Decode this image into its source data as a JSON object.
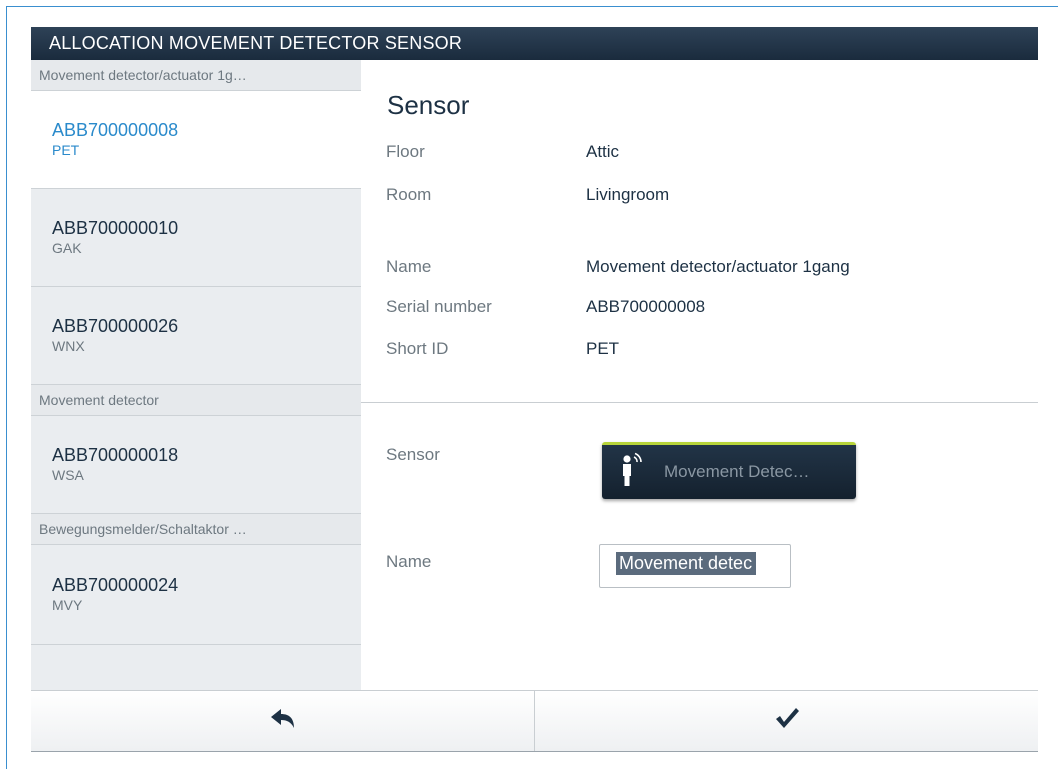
{
  "window": {
    "title": "ALLOCATION MOVEMENT DETECTOR SENSOR"
  },
  "sidebar": {
    "groups": [
      {
        "header": "Movement detector/actuator 1g…",
        "items": [
          {
            "serial": "ABB700000008",
            "short_id": "PET",
            "selected": true
          },
          {
            "serial": "ABB700000010",
            "short_id": "GAK",
            "selected": false
          },
          {
            "serial": "ABB700000026",
            "short_id": "WNX",
            "selected": false
          }
        ]
      },
      {
        "header": "Movement detector",
        "items": [
          {
            "serial": "ABB700000018",
            "short_id": "WSA",
            "selected": false
          }
        ]
      },
      {
        "header": "Bewegungsmelder/Schaltaktor …",
        "items": [
          {
            "serial": "ABB700000024",
            "short_id": "MVY",
            "selected": false
          }
        ]
      }
    ]
  },
  "details": {
    "section_title": "Sensor",
    "floor_label": "Floor",
    "floor_value": "Attic",
    "room_label": "Room",
    "room_value": "Livingroom",
    "name_label": "Name",
    "name_value": "Movement detector/actuator 1gang",
    "serial_label": "Serial number",
    "serial_value": "ABB700000008",
    "short_id_label": "Short ID",
    "short_id_value": "PET"
  },
  "config": {
    "sensor_label": "Sensor",
    "sensor_button_label": "Movement Detec…",
    "sensor_icon": "movement-detector-icon",
    "name_label": "Name",
    "name_input_value": "Movement detec"
  },
  "footer": {
    "back_icon": "back-arrow-icon",
    "confirm_icon": "checkmark-icon"
  },
  "colors": {
    "titlebar": "#1a2b3d",
    "accent_selected": "#2a8acb",
    "button_accent": "#b7d43a"
  }
}
